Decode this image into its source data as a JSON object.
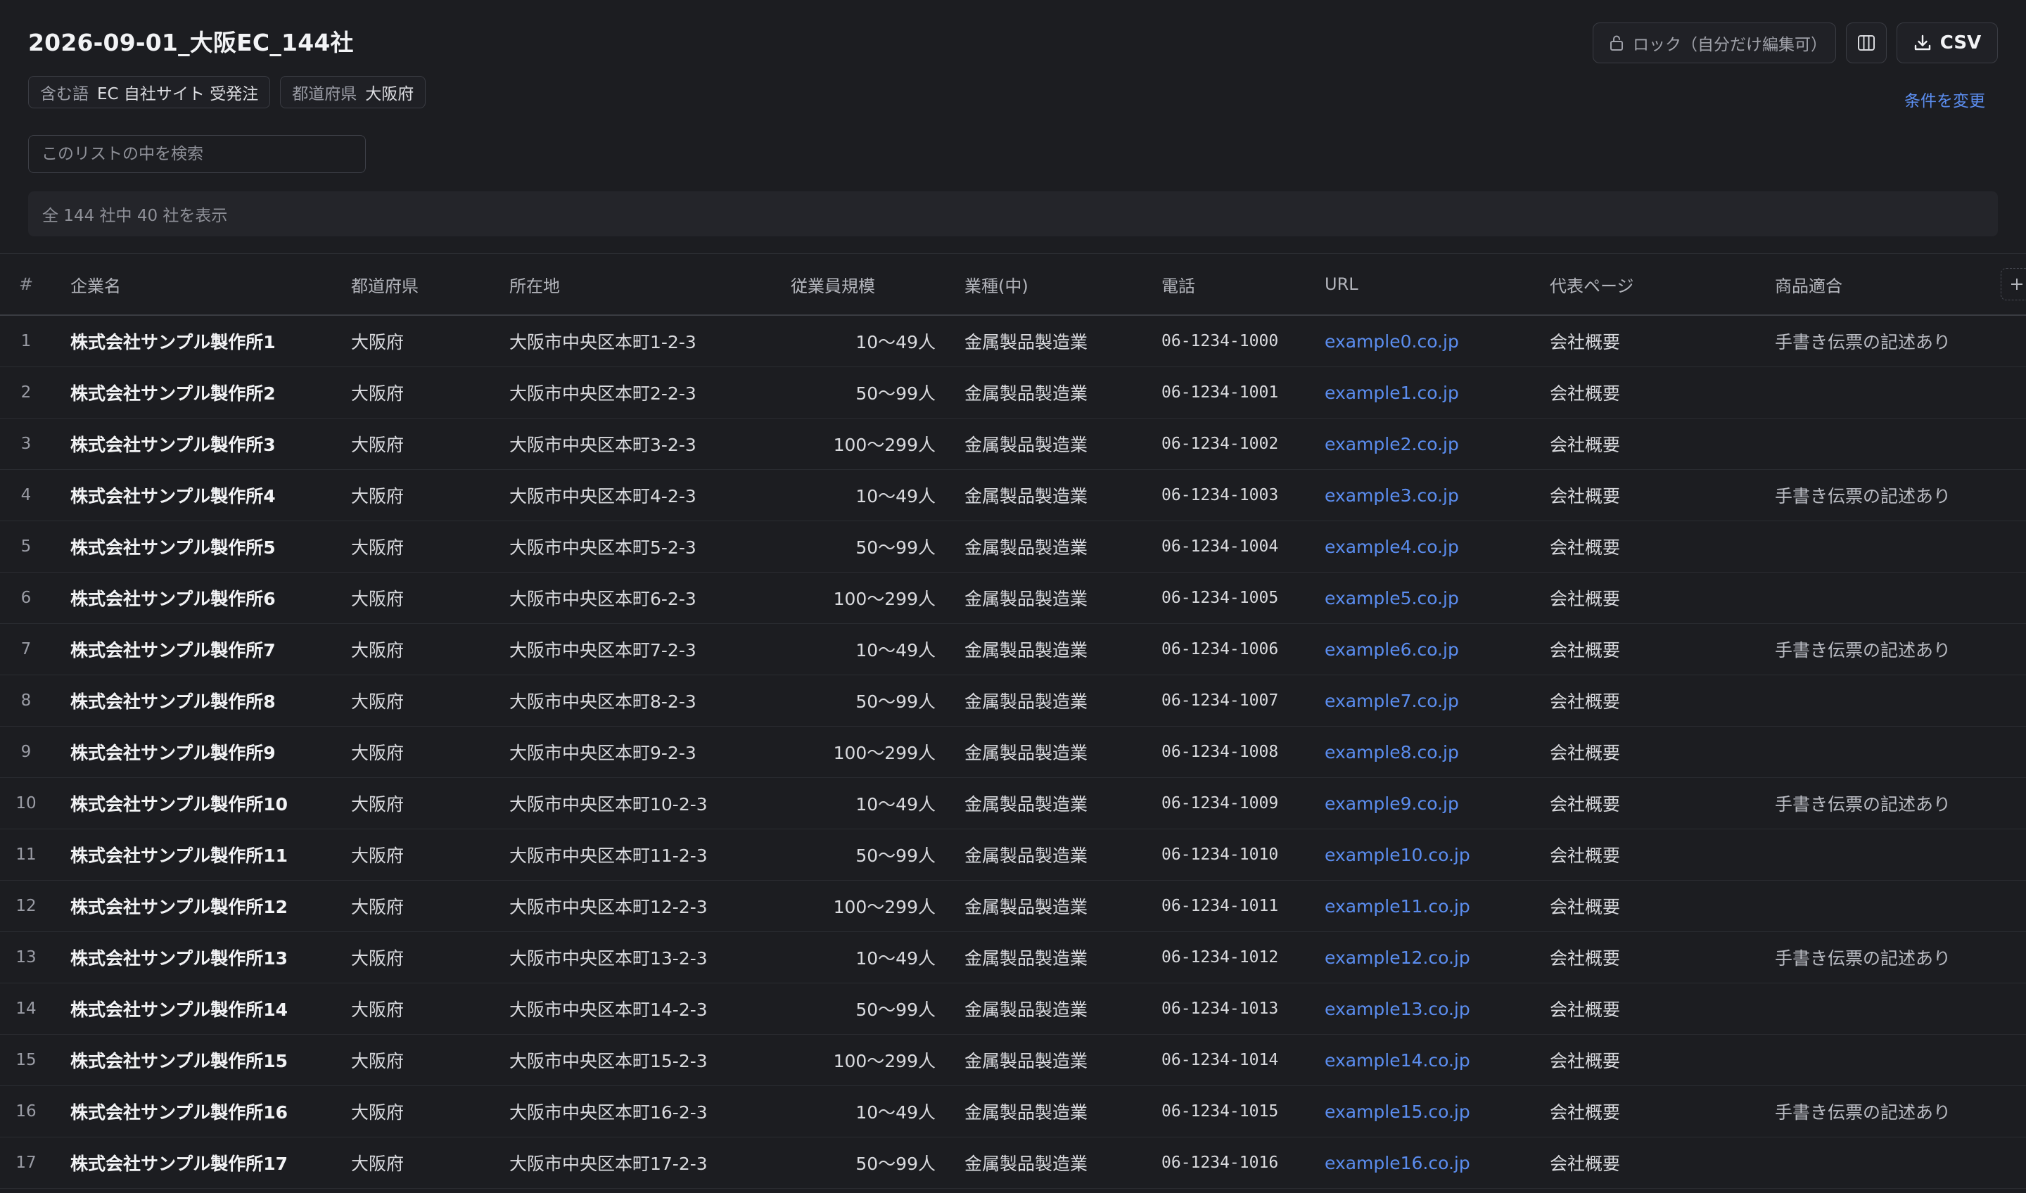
{
  "header": {
    "title": "2026-09-01_大阪EC_144社",
    "filters": [
      {
        "key": "含む語",
        "value": "EC 自社サイト 受発注"
      },
      {
        "key": "都道府県",
        "value": "大阪府"
      }
    ],
    "lock_label": "ロック（自分だけ編集可）",
    "csv_label": "CSV",
    "change_conditions_label": "条件を変更"
  },
  "search": {
    "placeholder": "このリストの中を検索",
    "value": ""
  },
  "summary": "全 144 社中 40 社を表示",
  "table": {
    "headers": {
      "index": "#",
      "name": "企業名",
      "prefecture": "都道府県",
      "address": "所在地",
      "employees": "従業員規模",
      "industry": "業種(中)",
      "phone": "電話",
      "url": "URL",
      "rep_page": "代表ページ",
      "product_fit": "商品適合"
    },
    "add_column_icon": "plus-icon",
    "rows": [
      {
        "index": "1",
        "name": "株式会社サンプル製作所1",
        "prefecture": "大阪府",
        "address": "大阪市中央区本町1-2-3",
        "employees": "10〜49人",
        "industry": "金属製品製造業",
        "phone": "06-1234-1000",
        "url": "example0.co.jp",
        "rep_page": "会社概要",
        "product_fit": "手書き伝票の記述あり"
      },
      {
        "index": "2",
        "name": "株式会社サンプル製作所2",
        "prefecture": "大阪府",
        "address": "大阪市中央区本町2-2-3",
        "employees": "50〜99人",
        "industry": "金属製品製造業",
        "phone": "06-1234-1001",
        "url": "example1.co.jp",
        "rep_page": "会社概要",
        "product_fit": ""
      },
      {
        "index": "3",
        "name": "株式会社サンプル製作所3",
        "prefecture": "大阪府",
        "address": "大阪市中央区本町3-2-3",
        "employees": "100〜299人",
        "industry": "金属製品製造業",
        "phone": "06-1234-1002",
        "url": "example2.co.jp",
        "rep_page": "会社概要",
        "product_fit": ""
      },
      {
        "index": "4",
        "name": "株式会社サンプル製作所4",
        "prefecture": "大阪府",
        "address": "大阪市中央区本町4-2-3",
        "employees": "10〜49人",
        "industry": "金属製品製造業",
        "phone": "06-1234-1003",
        "url": "example3.co.jp",
        "rep_page": "会社概要",
        "product_fit": "手書き伝票の記述あり"
      },
      {
        "index": "5",
        "name": "株式会社サンプル製作所5",
        "prefecture": "大阪府",
        "address": "大阪市中央区本町5-2-3",
        "employees": "50〜99人",
        "industry": "金属製品製造業",
        "phone": "06-1234-1004",
        "url": "example4.co.jp",
        "rep_page": "会社概要",
        "product_fit": ""
      },
      {
        "index": "6",
        "name": "株式会社サンプル製作所6",
        "prefecture": "大阪府",
        "address": "大阪市中央区本町6-2-3",
        "employees": "100〜299人",
        "industry": "金属製品製造業",
        "phone": "06-1234-1005",
        "url": "example5.co.jp",
        "rep_page": "会社概要",
        "product_fit": ""
      },
      {
        "index": "7",
        "name": "株式会社サンプル製作所7",
        "prefecture": "大阪府",
        "address": "大阪市中央区本町7-2-3",
        "employees": "10〜49人",
        "industry": "金属製品製造業",
        "phone": "06-1234-1006",
        "url": "example6.co.jp",
        "rep_page": "会社概要",
        "product_fit": "手書き伝票の記述あり"
      },
      {
        "index": "8",
        "name": "株式会社サンプル製作所8",
        "prefecture": "大阪府",
        "address": "大阪市中央区本町8-2-3",
        "employees": "50〜99人",
        "industry": "金属製品製造業",
        "phone": "06-1234-1007",
        "url": "example7.co.jp",
        "rep_page": "会社概要",
        "product_fit": ""
      },
      {
        "index": "9",
        "name": "株式会社サンプル製作所9",
        "prefecture": "大阪府",
        "address": "大阪市中央区本町9-2-3",
        "employees": "100〜299人",
        "industry": "金属製品製造業",
        "phone": "06-1234-1008",
        "url": "example8.co.jp",
        "rep_page": "会社概要",
        "product_fit": ""
      },
      {
        "index": "10",
        "name": "株式会社サンプル製作所10",
        "prefecture": "大阪府",
        "address": "大阪市中央区本町10-2-3",
        "employees": "10〜49人",
        "industry": "金属製品製造業",
        "phone": "06-1234-1009",
        "url": "example9.co.jp",
        "rep_page": "会社概要",
        "product_fit": "手書き伝票の記述あり"
      },
      {
        "index": "11",
        "name": "株式会社サンプル製作所11",
        "prefecture": "大阪府",
        "address": "大阪市中央区本町11-2-3",
        "employees": "50〜99人",
        "industry": "金属製品製造業",
        "phone": "06-1234-1010",
        "url": "example10.co.jp",
        "rep_page": "会社概要",
        "product_fit": ""
      },
      {
        "index": "12",
        "name": "株式会社サンプル製作所12",
        "prefecture": "大阪府",
        "address": "大阪市中央区本町12-2-3",
        "employees": "100〜299人",
        "industry": "金属製品製造業",
        "phone": "06-1234-1011",
        "url": "example11.co.jp",
        "rep_page": "会社概要",
        "product_fit": ""
      },
      {
        "index": "13",
        "name": "株式会社サンプル製作所13",
        "prefecture": "大阪府",
        "address": "大阪市中央区本町13-2-3",
        "employees": "10〜49人",
        "industry": "金属製品製造業",
        "phone": "06-1234-1012",
        "url": "example12.co.jp",
        "rep_page": "会社概要",
        "product_fit": "手書き伝票の記述あり"
      },
      {
        "index": "14",
        "name": "株式会社サンプル製作所14",
        "prefecture": "大阪府",
        "address": "大阪市中央区本町14-2-3",
        "employees": "50〜99人",
        "industry": "金属製品製造業",
        "phone": "06-1234-1013",
        "url": "example13.co.jp",
        "rep_page": "会社概要",
        "product_fit": ""
      },
      {
        "index": "15",
        "name": "株式会社サンプル製作所15",
        "prefecture": "大阪府",
        "address": "大阪市中央区本町15-2-3",
        "employees": "100〜299人",
        "industry": "金属製品製造業",
        "phone": "06-1234-1014",
        "url": "example14.co.jp",
        "rep_page": "会社概要",
        "product_fit": ""
      },
      {
        "index": "16",
        "name": "株式会社サンプル製作所16",
        "prefecture": "大阪府",
        "address": "大阪市中央区本町16-2-3",
        "employees": "10〜49人",
        "industry": "金属製品製造業",
        "phone": "06-1234-1015",
        "url": "example15.co.jp",
        "rep_page": "会社概要",
        "product_fit": "手書き伝票の記述あり"
      },
      {
        "index": "17",
        "name": "株式会社サンプル製作所17",
        "prefecture": "大阪府",
        "address": "大阪市中央区本町17-2-3",
        "employees": "50〜99人",
        "industry": "金属製品製造業",
        "phone": "06-1234-1016",
        "url": "example16.co.jp",
        "rep_page": "会社概要",
        "product_fit": ""
      }
    ]
  },
  "icons": {
    "lock": "lock-icon",
    "columns": "columns-icon",
    "download": "download-icon"
  },
  "colors": {
    "background": "#1c1d21",
    "link": "#5b8def",
    "text": "#e6e7ea",
    "muted": "#8e9098"
  }
}
